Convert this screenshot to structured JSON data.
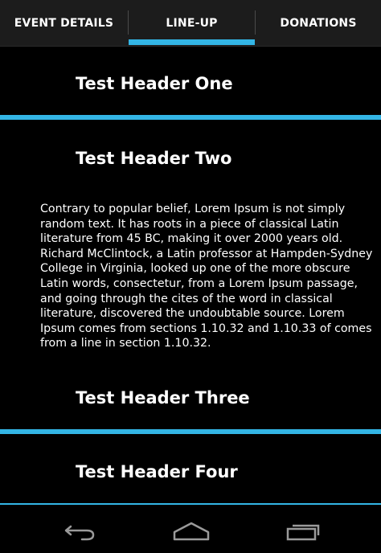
{
  "tabs": [
    {
      "label": "EVENT DETAILS",
      "selected": false
    },
    {
      "label": "LINE-UP",
      "selected": true
    },
    {
      "label": "DONATIONS",
      "selected": false
    }
  ],
  "sections": [
    {
      "header": "Test Header One"
    },
    {
      "header": "Test Header Two",
      "body": "Contrary to popular belief, Lorem Ipsum is not simply random text. It has roots in a piece of classical Latin literature from 45 BC, making it over 2000 years old. Richard McClintock, a Latin professor at Hampden-Sydney College in Virginia, looked up one of the more obscure Latin words, consectetur, from a Lorem Ipsum passage, and going through the cites of the word in classical literature, discovered the undoubtable source. Lorem Ipsum comes from sections 1.10.32 and 1.10.33 of comes from a line in section 1.10.32."
    },
    {
      "header": "Test Header Three"
    },
    {
      "header": "Test Header Four"
    }
  ],
  "navigation": {
    "back_icon": "back-arrow-icon",
    "home_icon": "home-icon",
    "recents_icon": "recent-apps-icon"
  },
  "colors": {
    "accent": "#33b5e5",
    "background": "#000000",
    "tab_bar": "#1c1c1c",
    "text": "#ffffff"
  }
}
